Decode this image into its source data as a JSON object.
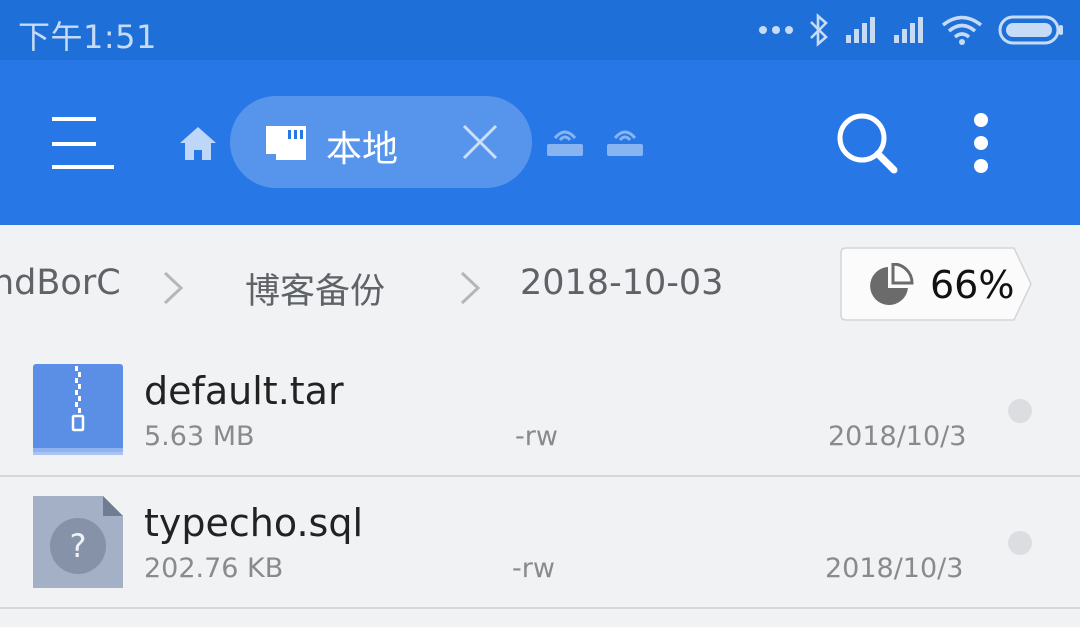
{
  "status_bar": {
    "time": "下午1:51",
    "icons": [
      "dots-icon",
      "bluetooth-icon",
      "signal-icon",
      "signal-icon",
      "wifi-icon",
      "battery-icon"
    ]
  },
  "toolbar": {
    "storage_tab_label": "本地",
    "icons": [
      "menu-icon",
      "home-icon",
      "sd-card-icon",
      "close-icon",
      "network-drive-icon",
      "search-icon",
      "more-vert-icon"
    ]
  },
  "breadcrumb": {
    "items": [
      "ndBorC",
      "博客备份",
      "2018-10-03"
    ],
    "storage_usage": "66%"
  },
  "files": [
    {
      "name": "default.tar",
      "size": "5.63 MB",
      "permissions": "-rw",
      "date": "2018/10/3",
      "icon": "archive-icon"
    },
    {
      "name": "typecho.sql",
      "size": "202.76 KB",
      "permissions": "-rw",
      "date": "2018/10/3",
      "icon": "unknown-file-icon"
    }
  ],
  "colors": {
    "status_bar": "#1f6fd8",
    "toolbar": "#2778e6",
    "background": "#f1f2f4",
    "archive_icon": "#5b8fe6",
    "unknown_icon": "#a3b0c6"
  }
}
